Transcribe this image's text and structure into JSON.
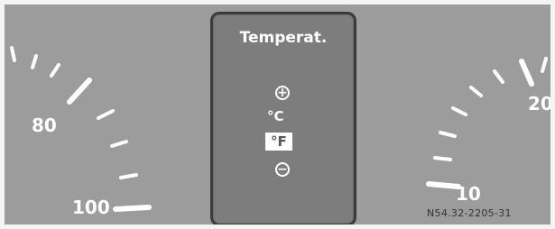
{
  "left_gauge": {
    "labels": [
      "80",
      "100"
    ]
  },
  "right_gauge": {
    "labels": [
      "20",
      "10"
    ]
  },
  "menu": {
    "title": "Temperat.",
    "up_icon": "plus-circle-icon",
    "down_icon": "minus-circle-icon",
    "options": [
      "°C",
      "°F"
    ],
    "selected": "°F"
  },
  "reference_code": "N54.32-2205-31",
  "colors": {
    "dial": "#9c9c9c",
    "panel": "#7d7d7d",
    "panel_border": "#3a3a3a",
    "markings": "#ffffff",
    "highlight_bg": "#ffffff",
    "highlight_text": "#555555"
  }
}
